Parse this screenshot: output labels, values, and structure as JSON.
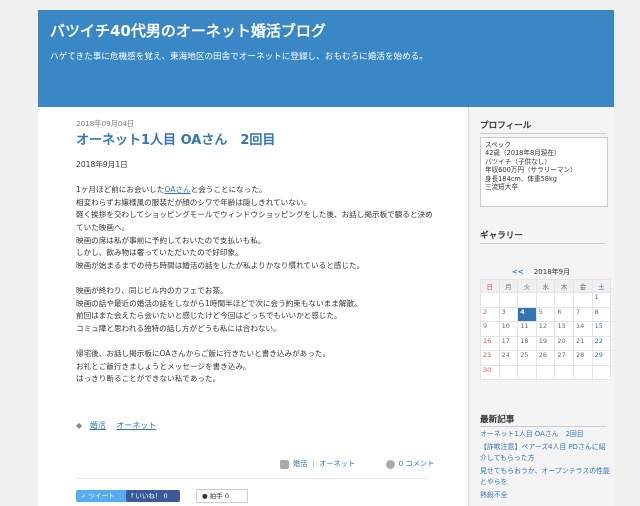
{
  "header": {
    "title": "バツイチ40代男のオーネット婚活ブログ",
    "description": "ハゲてきた事に危機感を覚え、東海地区の田舎でオーネットに登録し、おもむろに婚活を始める。"
  },
  "post": {
    "date": "2018年09月04日",
    "title": "オーネット1人目 OAさん　2回目",
    "body": {
      "dateline": "2018年9月1日",
      "l1_pre": "1ヶ月ほど前にお会いした",
      "l1_link": "OAさん",
      "l1_post": "と会うことになった。",
      "l2": "相変わらずお嬢様風の服装だが顔のシワで年齢は隠しきれていない。",
      "l3": "軽く挨拶を交わしてショッピングモールでウィンドウショッピングをした後、お話し掲示板で観ると決めていた映画へ。",
      "l4": "映画の席は私が事前に予約しておいたので支払いも私。",
      "l5": "しかし、飲み物は奢っていただいたので好印象。",
      "l6": "映画が始まるまでの待ち時間は婚活の話をしたが私よりかなり慣れていると感じた。",
      "l7": "映画が終わり、同じビル内のカフェでお茶。",
      "l8": "映画の話や最近の婚活の話をしながら1時間半ほどで次に会う約束もないまま解散。",
      "l9": "前回はまた会えたら会いたいと感じたけど今回はどっちでもいいかと感じた。",
      "l10": "コミュ障と思われる独特の話し方がどうも私には合わない。",
      "l11": "帰宅後、お話し掲示板にOAさんからご飯に行きたいと書き込みがあった。",
      "l12": "お礼とご飯行きましょうとメッセージを書き込み。",
      "l13": "はっきり断ることができない私であった。"
    },
    "tags": [
      "婚活",
      "オーネット"
    ],
    "meta": {
      "categories": "婚活 ｜ オーネット",
      "comments": "0 コメント"
    },
    "share": {
      "tweet": "ツイート",
      "like": "いいね！ 0",
      "like_count": "0",
      "hakushu": "拍手 0",
      "hakushu_count": "0"
    }
  },
  "sidebar": {
    "profile": {
      "heading": "プロフィール",
      "lines": [
        "スペック",
        "42歳（2018年8月現在）",
        "バツイチ（子供なし）",
        "年収600万円（サラリーマン）",
        "身長184cm、体重58kg",
        "三流短大卒"
      ]
    },
    "gallery": {
      "heading": "ギャラリー"
    },
    "calendar": {
      "prev": "<<",
      "month": "2018年9月",
      "weekdays": [
        "日",
        "月",
        "火",
        "水",
        "木",
        "金",
        "土"
      ],
      "rows": [
        [
          "",
          "",
          "",
          "",
          "",
          "",
          "1"
        ],
        [
          "2",
          "3",
          "4",
          "5",
          "6",
          "7",
          "8"
        ],
        [
          "9",
          "10",
          "11",
          "12",
          "13",
          "14",
          "15"
        ],
        [
          "16",
          "17",
          "18",
          "19",
          "20",
          "21",
          "22"
        ],
        [
          "23",
          "24",
          "25",
          "26",
          "27",
          "28",
          "29"
        ],
        [
          "30",
          "",
          "",
          "",
          "",
          "",
          ""
        ]
      ],
      "today": "4"
    },
    "recent": {
      "heading": "最新記事",
      "items": [
        "オーネット1人目 OAさん　2回目",
        "【詐欺注意】ペアーズ4人目 PDさんに紹介してもらった方",
        "見せてもらおうか、オープンテラスの性能とやらを",
        "熱殺不全"
      ]
    }
  }
}
